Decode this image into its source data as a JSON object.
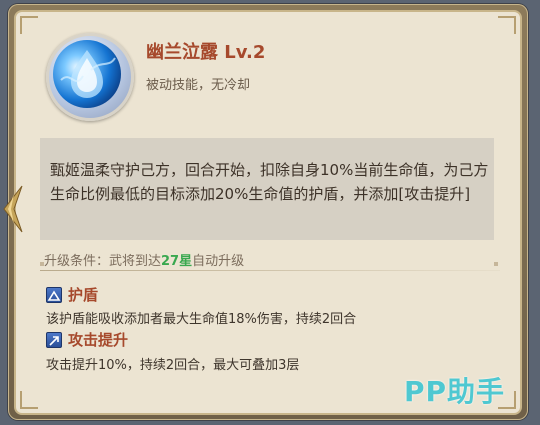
{
  "skill": {
    "name": "幽兰泣露 Lv.2",
    "subtitle": "被动技能，无冷却",
    "icon": "water-droplet-icon",
    "description": "甄姬温柔守护己方，回合开始，扣除自身10%当前生命值，为己方生命比例最低的目标添加20%生命值的护盾，并添加[攻击提升]"
  },
  "upgrade": {
    "prefix": "升级条件：武将到达",
    "stars": "27星",
    "suffix": "自动升级"
  },
  "effects": [
    {
      "title": "护盾",
      "description": "该护盾能吸收添加者最大生命值18%伤害，持续2回合",
      "icon": "shield-buff-icon"
    },
    {
      "title": "攻击提升",
      "description": "攻击提升10%，持续2回合，最大可叠加3层",
      "icon": "attack-up-buff-icon"
    }
  ],
  "watermark": "PP助手",
  "colors": {
    "title": "#a6492c",
    "stars": "#39a84f",
    "watermark": "#4fc8d1"
  }
}
